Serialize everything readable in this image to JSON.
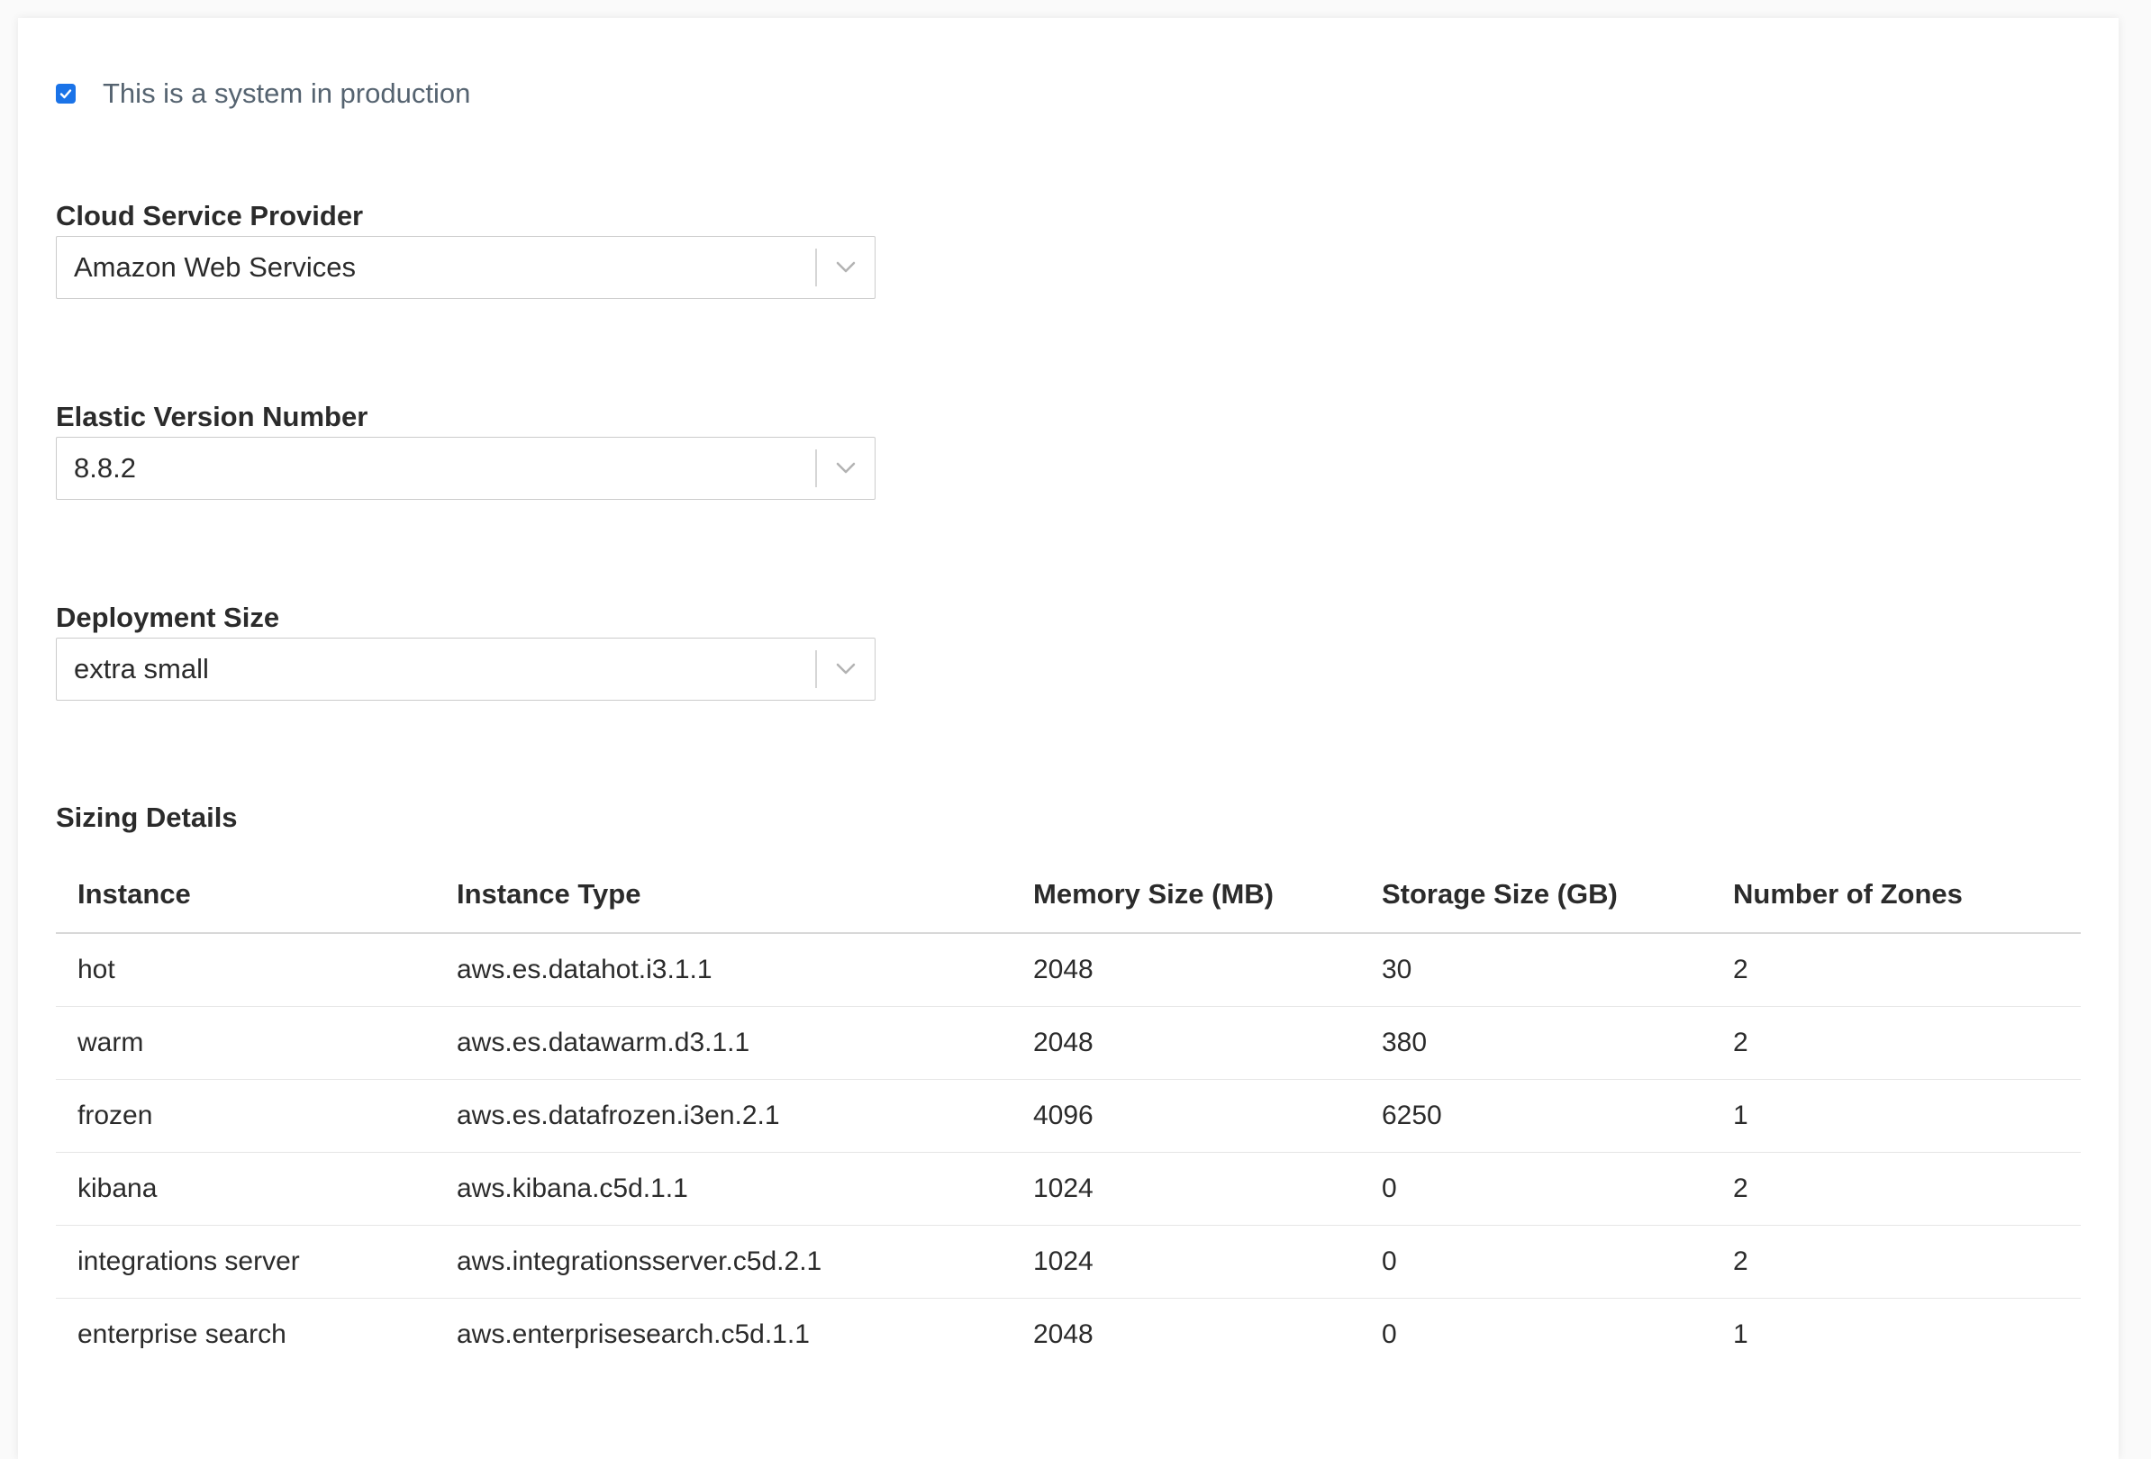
{
  "production": {
    "checked": true,
    "label": "This is a system in production"
  },
  "fields": {
    "provider": {
      "label": "Cloud Service Provider",
      "value": "Amazon Web Services"
    },
    "version": {
      "label": "Elastic Version Number",
      "value": "8.8.2"
    },
    "size": {
      "label": "Deployment Size",
      "value": "extra small"
    }
  },
  "sizing": {
    "title": "Sizing Details",
    "headers": [
      "Instance",
      "Instance Type",
      "Memory Size (MB)",
      "Storage Size (GB)",
      "Number of Zones"
    ],
    "rows": [
      [
        "hot",
        "aws.es.datahot.i3.1.1",
        "2048",
        "30",
        "2"
      ],
      [
        "warm",
        "aws.es.datawarm.d3.1.1",
        "2048",
        "380",
        "2"
      ],
      [
        "frozen",
        "aws.es.datafrozen.i3en.2.1",
        "4096",
        "6250",
        "1"
      ],
      [
        "kibana",
        "aws.kibana.c5d.1.1",
        "1024",
        "0",
        "2"
      ],
      [
        "integrations server",
        "aws.integrationsserver.c5d.2.1",
        "1024",
        "0",
        "2"
      ],
      [
        "enterprise search",
        "aws.enterprisesearch.c5d.1.1",
        "2048",
        "0",
        "1"
      ]
    ]
  },
  "colors": {
    "accent": "#1a73e8",
    "muted_text": "#556370",
    "border": "#cccccc"
  }
}
